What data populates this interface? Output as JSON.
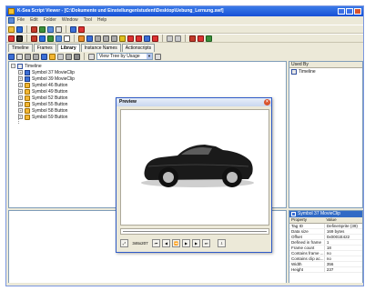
{
  "window": {
    "title": "K-Sea Script Viewer - [C:\\Dokumente und Einstellungen\\student\\Desktop\\Uebung_Lernung.swf]"
  },
  "menu": {
    "items": [
      "File",
      "Edit",
      "Folder",
      "Window",
      "Tool",
      "Help"
    ]
  },
  "tabs": [
    {
      "label": "Timeline",
      "active": false
    },
    {
      "label": "Frames",
      "active": false
    },
    {
      "label": "Library",
      "active": true
    },
    {
      "label": "Instance Names",
      "active": false
    },
    {
      "label": "Actionscripts",
      "active": false
    }
  ],
  "view": {
    "select_value": "View Tree by Usage"
  },
  "tree": {
    "root": "Timeline",
    "items": [
      {
        "label": "Symbol 37 MovieClip",
        "kind": "movie"
      },
      {
        "label": "Symbol 39 MovieClip",
        "kind": "movie"
      },
      {
        "label": "Symbol 46 Button",
        "kind": "button"
      },
      {
        "label": "Symbol 49 Button",
        "kind": "button"
      },
      {
        "label": "Symbol 52 Button",
        "kind": "button"
      },
      {
        "label": "Symbol 55 Button",
        "kind": "button"
      },
      {
        "label": "Symbol 58 Button",
        "kind": "button"
      },
      {
        "label": "Symbol 59 Button",
        "kind": "button"
      }
    ]
  },
  "used_by": {
    "header": "Used By",
    "items": [
      "Timeline"
    ]
  },
  "properties": {
    "title": "Symbol 37 MovieClip",
    "col_property": "Property",
    "col_value": "Value",
    "rows": [
      {
        "property": "Tag ID",
        "value": "DefineSprite (39)"
      },
      {
        "property": "Data size",
        "value": "169 bytes"
      },
      {
        "property": "Offset",
        "value": "0x0001E422"
      },
      {
        "property": "Defined in frame",
        "value": "1"
      },
      {
        "property": "Frame count",
        "value": "18"
      },
      {
        "property": "Contains frame ...",
        "value": "no"
      },
      {
        "property": "Contains clip ac...",
        "value": "no"
      },
      {
        "property": "Width",
        "value": "356"
      },
      {
        "property": "Height",
        "value": "237"
      }
    ]
  },
  "preview": {
    "title": "Preview",
    "dimensions": "346x207"
  },
  "colors": {
    "titlebar": "#1650d6",
    "selection": "#316ac5",
    "car_body": "#1a1a1a"
  },
  "icons": {
    "movieclip": "movieclip-icon",
    "button": "button-symbol-icon",
    "timeline": "timeline-icon"
  }
}
